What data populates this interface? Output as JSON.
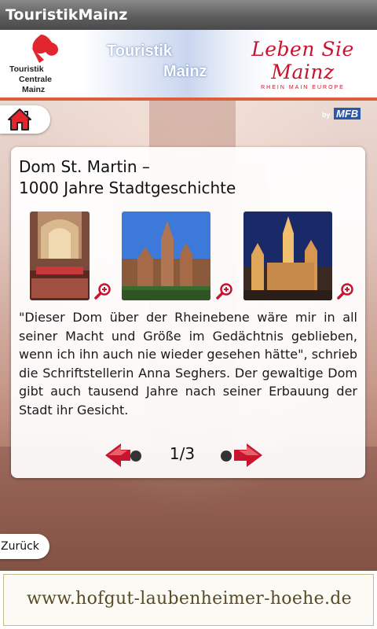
{
  "app": {
    "title": "TouristikMainz"
  },
  "header": {
    "tcm_logo": [
      "Touristik",
      "Centrale",
      "Mainz"
    ],
    "tm_wordmark": [
      "Touristik",
      "Mainz"
    ],
    "lsm_script": "Leben Sie Mainz",
    "lsm_sub": "RHEIN MAIN EUROPE",
    "by_label": "by",
    "mfb_label": "MFB"
  },
  "card": {
    "title": "Dom St. Martin –\n1000 Jahre Stadtgeschichte",
    "quote": "\"Dieser Dom über der Rheinebene wäre mir in all seiner Macht und Größe im Gedächtnis geblieben, wenn ich ihn auch nie wieder gesehen hätte\", schrieb die Schriftstellerin Anna Seghers. Der gewaltige Dom gibt auch tausend Jahre nach seiner Erbauung der Stadt ihr Gesicht.",
    "page_indicator": "1/3"
  },
  "nav": {
    "back_label": "Zurück"
  },
  "ad": {
    "url": "www.hofgut-laubenheimer-hoehe.de"
  },
  "colors": {
    "accent_red": "#c8142e",
    "banner_line": "#d9603a"
  }
}
